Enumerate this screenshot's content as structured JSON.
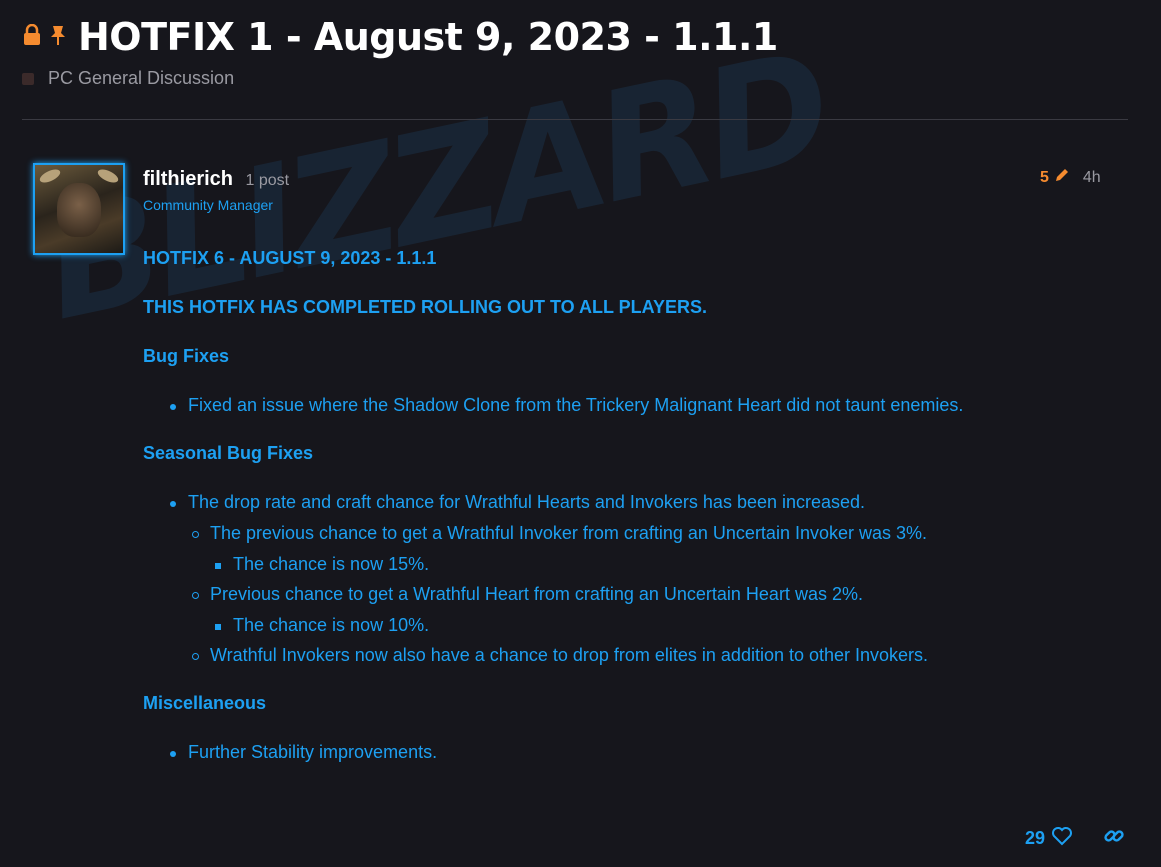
{
  "topic": {
    "title": "HOTFIX 1 - August 9, 2023 - 1.1.1",
    "category": "PC General Discussion",
    "icons": [
      "lock-icon",
      "pin-icon"
    ]
  },
  "post": {
    "username": "filthierich",
    "post_count": "1 post",
    "user_title": "Community Manager",
    "edit_count": "5",
    "age": "4h",
    "likes": "29",
    "content": {
      "title": "HOTFIX 6 - AUGUST 9, 2023 - 1.1.1",
      "notice": "THIS HOTFIX HAS COMPLETED ROLLING OUT TO ALL PLAYERS.",
      "bug_heading": "Bug Fixes",
      "bug_items": [
        "Fixed an issue where the Shadow Clone from the Trickery Malignant Heart did not taunt enemies."
      ],
      "seasonal_heading": "Seasonal Bug Fixes",
      "seasonal": {
        "item": "The drop rate and craft chance for Wrathful Hearts and Invokers has been increased.",
        "sub1": "The previous chance to get a Wrathful Invoker from crafting an Uncertain Invoker was 3%.",
        "sub1a": "The chance is now 15%.",
        "sub2": "Previous chance to get a Wrathful Heart from crafting an Uncertain Heart was 2%.",
        "sub2a": "The chance is now 10%.",
        "sub3": "Wrathful Invokers now also have a chance to drop from elites in addition to other Invokers."
      },
      "misc_heading": "Miscellaneous",
      "misc_items": [
        "Further Stability improvements."
      ]
    }
  },
  "colors": {
    "accent": "#1da0f2",
    "edit": "#f58b2f",
    "background": "#16161c"
  }
}
